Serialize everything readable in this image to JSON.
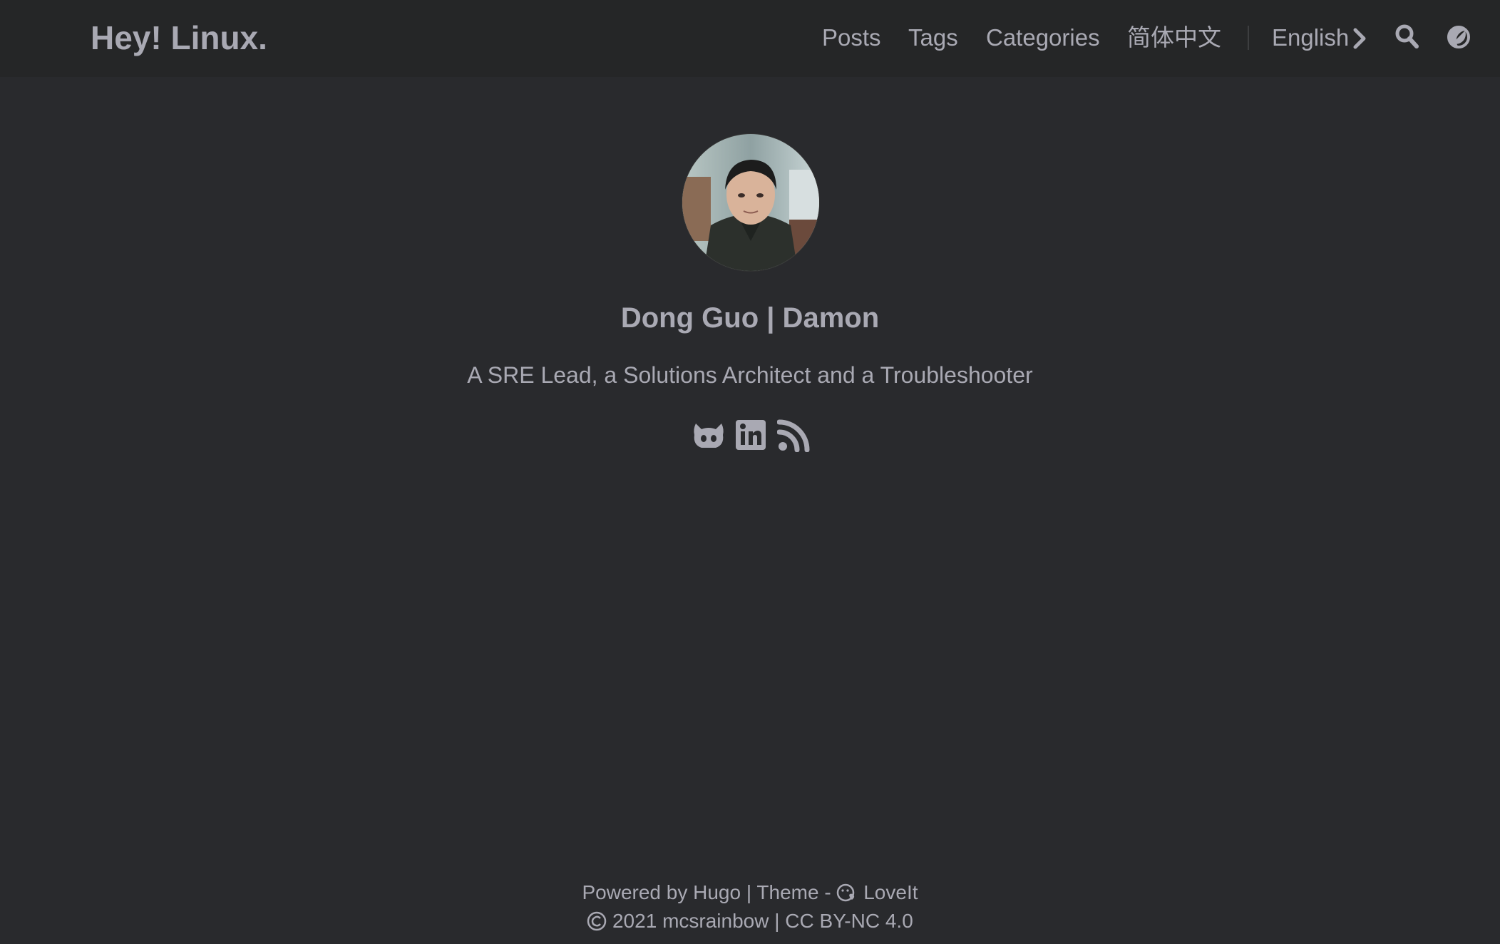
{
  "header": {
    "logo": "Hey! Linux.",
    "nav": {
      "posts": "Posts",
      "tags": "Tags",
      "categories": "Categories",
      "chinese": "简体中文",
      "language": "English"
    },
    "icons": [
      "search-icon",
      "theme-toggle-icon",
      "chevron-right-icon"
    ]
  },
  "profile": {
    "name": "Dong Guo | Damon",
    "subtitle": "A SRE Lead, a Solutions Architect and a Troubleshooter",
    "social_icons": [
      "github-icon",
      "linkedin-icon",
      "rss-icon"
    ]
  },
  "footer": {
    "powered_by": "Powered by",
    "hugo": "Hugo",
    "sep1": "|",
    "theme": "Theme -",
    "loveit": "LoveIt",
    "year": "2021",
    "owner": "mcsrainbow",
    "sep2": "|",
    "license": "CC BY-NC 4.0"
  },
  "colors": {
    "background": "#292a2d",
    "header": "#252627",
    "text": "#a9a9b3"
  }
}
